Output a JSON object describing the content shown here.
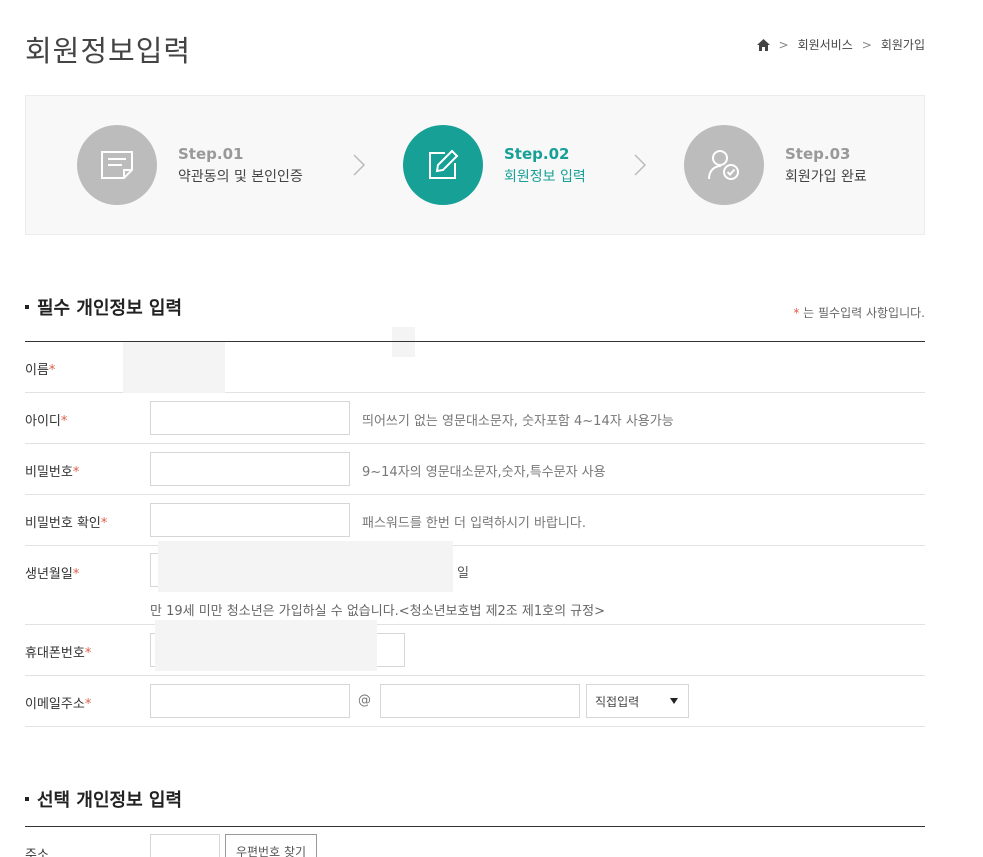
{
  "page": {
    "title": "회원정보입력"
  },
  "breadcrumb": {
    "items": [
      "회원서비스",
      "회원가입"
    ]
  },
  "steps": [
    {
      "num": "Step.01",
      "label": "약관동의 및 본인인증",
      "icon": "document-icon"
    },
    {
      "num": "Step.02",
      "label": "회원정보 입력",
      "icon": "edit-pencil-icon"
    },
    {
      "num": "Step.03",
      "label": "회원가입 완료",
      "icon": "user-check-icon"
    }
  ],
  "colors": {
    "accent": "#17a096",
    "inactive_step": "#bcbcbc",
    "required_star": "#e05c49"
  },
  "required_section": {
    "title": "필수 개인정보 입력",
    "note": "는 필수입력 사항입니다.",
    "star": "*",
    "fields": {
      "name": {
        "label": "이름"
      },
      "id": {
        "label": "아이디",
        "help": "띄어쓰기 없는 영문대소문자, 숫자포함 4~14자 사용가능"
      },
      "password": {
        "label": "비밀번호",
        "help": "9~14자의 영문대소문자,숫자,특수문자 사용"
      },
      "password_confirm": {
        "label": "비밀번호 확인",
        "help": "패스워드를 한번 더 입력하시기 바랍니다."
      },
      "birth": {
        "label": "생년월일",
        "day_suffix": "일",
        "help": "만 19세 미만 청소년은 가입하실 수 없습니다.<청소년보호법 제2조 제1호의 규정>"
      },
      "phone": {
        "label": "휴대폰번호"
      },
      "email": {
        "label": "이메일주소",
        "at": "@",
        "domain_select": "직접입력"
      }
    }
  },
  "optional_section": {
    "title": "선택 개인정보 입력",
    "fields": {
      "address": {
        "label": "주소",
        "zip_button": "우편번호 찾기"
      }
    }
  }
}
